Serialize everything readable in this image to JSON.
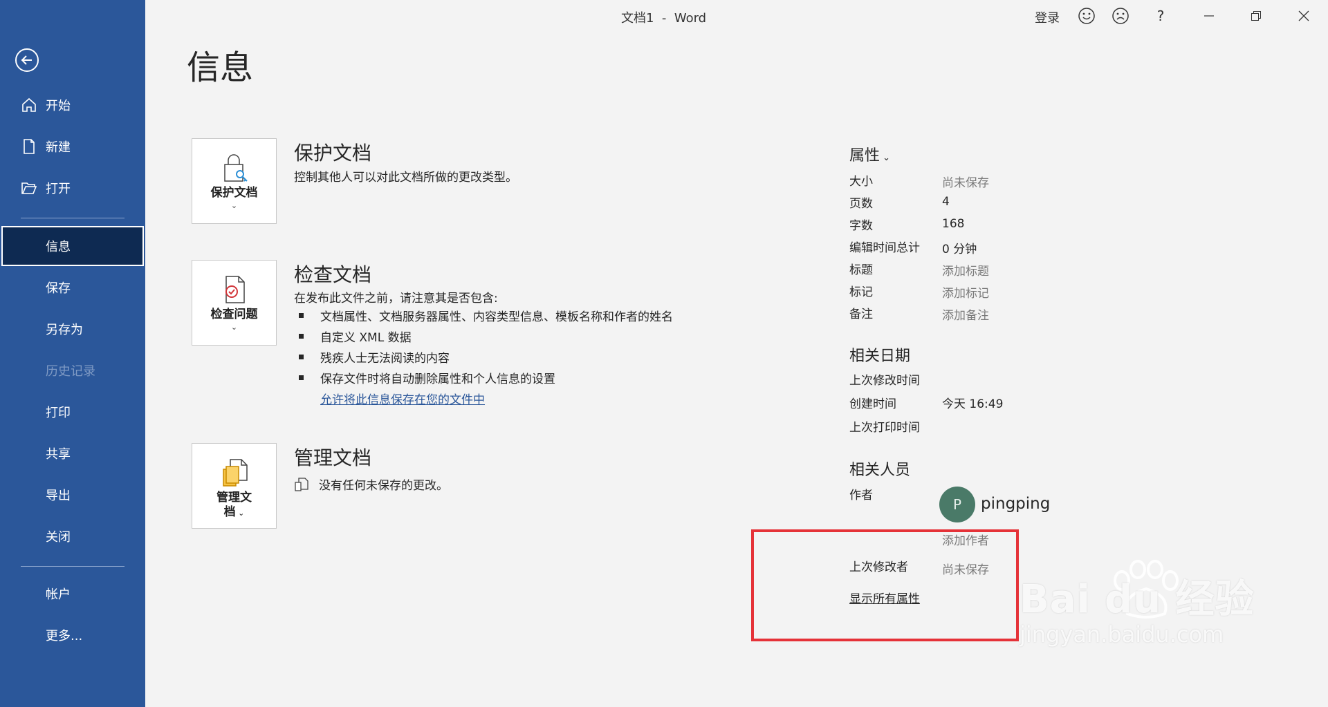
{
  "titlebar": {
    "title": "文档1  -  Word",
    "signin": "登录",
    "help": "?"
  },
  "sidebar": {
    "items": [
      {
        "label": "开始",
        "icon": "home-icon"
      },
      {
        "label": "新建",
        "icon": "new-document-icon"
      },
      {
        "label": "打开",
        "icon": "open-folder-icon"
      },
      {
        "label": "信息",
        "state": "selected"
      },
      {
        "label": "保存"
      },
      {
        "label": "另存为"
      },
      {
        "label": "历史记录",
        "state": "disabled"
      },
      {
        "label": "打印"
      },
      {
        "label": "共享"
      },
      {
        "label": "导出"
      },
      {
        "label": "关闭"
      },
      {
        "label": "帐户"
      },
      {
        "label": "更多..."
      }
    ]
  },
  "main": {
    "title": "信息",
    "protect": {
      "button_label": "保护文档",
      "title": "保护文档",
      "desc": "控制其他人可以对此文档所做的更改类型。"
    },
    "inspect": {
      "button_label": "检查问题",
      "title": "检查文档",
      "desc": "在发布此文件之前，请注意其是否包含:",
      "bullets": [
        "文档属性、文档服务器属性、内容类型信息、模板名称和作者的姓名",
        "自定义 XML 数据",
        "残疾人士无法阅读的内容",
        "保存文件时将自动删除属性和个人信息的设置"
      ],
      "link": "允许将此信息保存在您的文件中"
    },
    "manage": {
      "button_label_line1": "管理文",
      "button_label_line2": "档",
      "title": "管理文档",
      "desc": "没有任何未保存的更改。"
    }
  },
  "properties": {
    "header": "属性",
    "rows": [
      {
        "label": "大小",
        "value": "尚未保存"
      },
      {
        "label": "页数",
        "value": "4"
      },
      {
        "label": "字数",
        "value": "168"
      },
      {
        "label": "编辑时间总计",
        "value": "0 分钟"
      },
      {
        "label": "标题",
        "value": "添加标题"
      },
      {
        "label": "标记",
        "value": "添加标记"
      },
      {
        "label": "备注",
        "value": "添加备注"
      }
    ],
    "dates_header": "相关日期",
    "dates": [
      {
        "label": "上次修改时间",
        "value": ""
      },
      {
        "label": "创建时间",
        "value": "今天 16:49"
      },
      {
        "label": "上次打印时间",
        "value": ""
      }
    ],
    "people_header": "相关人员",
    "author_label": "作者",
    "author_initial": "P",
    "author_name": "pingping",
    "add_author": "添加作者",
    "last_modified_by_label": "上次修改者",
    "last_modified_by_value": "尚未保存",
    "show_all": "显示所有属性"
  },
  "watermark": {
    "logo": "Bai du 经验",
    "url": "jingyan.baidu.com"
  },
  "colors": {
    "sidebar": "#2b579a",
    "selected": "#0e2a52",
    "highlight": "#e53238"
  }
}
